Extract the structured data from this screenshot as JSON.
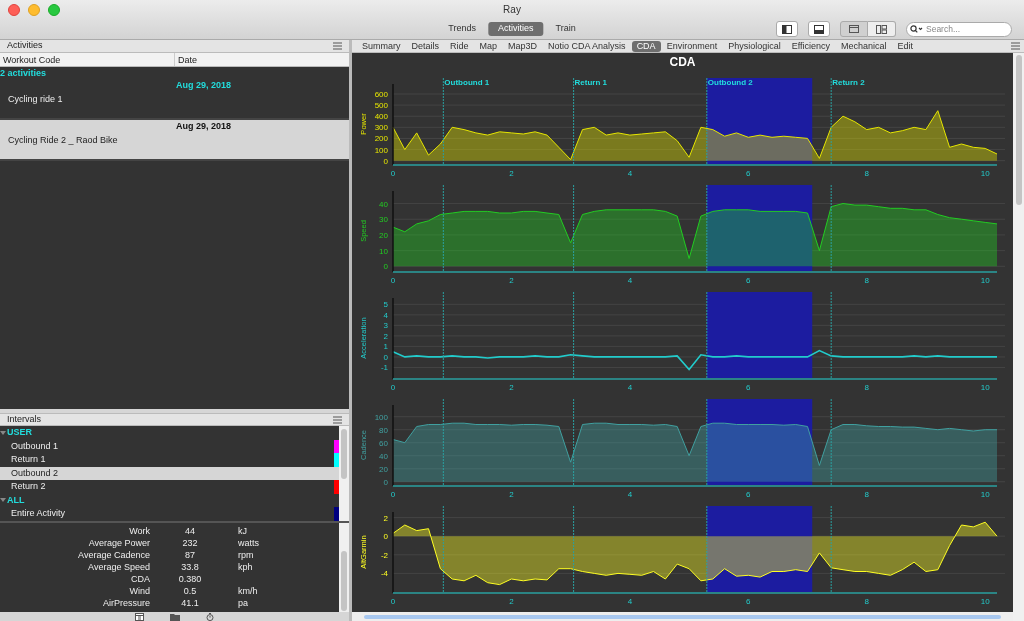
{
  "window": {
    "title": "Ray"
  },
  "view_tabs": [
    {
      "label": "Trends",
      "selected": false
    },
    {
      "label": "Activities",
      "selected": true
    },
    {
      "label": "Train",
      "selected": false
    }
  ],
  "search": {
    "placeholder": "Search..."
  },
  "activities_panel": {
    "title": "Activities",
    "columns": [
      "Workout Code",
      "Date"
    ],
    "group_label": "2 activities",
    "rows": [
      {
        "date": "Aug 29, 2018",
        "name": "Cycling ride 1",
        "selected": false
      },
      {
        "date": "Aug 29, 2018",
        "name": "Cycling Ride 2 _ Raod Bike",
        "selected": true
      }
    ]
  },
  "intervals_panel": {
    "title": "Intervals",
    "groups": [
      {
        "label": "USER",
        "expanded": true,
        "children": [
          {
            "label": "Outbound 1",
            "selected": false,
            "color": "#ff00ff"
          },
          {
            "label": "Return 1",
            "selected": false,
            "color": "#00ffff"
          },
          {
            "label": "Outbound 2",
            "selected": true
          },
          {
            "label": "Return 2",
            "selected": false,
            "color": "#ff0000"
          }
        ]
      },
      {
        "label": "ALL",
        "expanded": true,
        "children": [
          {
            "label": "Entire Activity",
            "selected": false,
            "color": "#000080"
          }
        ]
      }
    ]
  },
  "stats": [
    {
      "label": "Work",
      "value": "44",
      "unit": "kJ"
    },
    {
      "label": "Average Power",
      "value": "232",
      "unit": "watts"
    },
    {
      "label": "Average Cadence",
      "value": "87",
      "unit": "rpm"
    },
    {
      "label": "Average Speed",
      "value": "33.8",
      "unit": "kph"
    },
    {
      "label": "CDA",
      "value": "0.380"
    },
    {
      "label": "Wind",
      "value": "0.5",
      "unit": "km/h"
    },
    {
      "label": "AirPressure",
      "value": "41.1",
      "unit": "pa"
    }
  ],
  "tabs": [
    {
      "label": "Summary",
      "selected": false
    },
    {
      "label": "Details",
      "selected": false
    },
    {
      "label": "Ride",
      "selected": false
    },
    {
      "label": "Map",
      "selected": false
    },
    {
      "label": "Map3D",
      "selected": false
    },
    {
      "label": "Notio CDA Analysis",
      "selected": false
    },
    {
      "label": "CDA",
      "selected": true
    },
    {
      "label": "Environment",
      "selected": false
    },
    {
      "label": "Physiological",
      "selected": false
    },
    {
      "label": "Efficiency",
      "selected": false
    },
    {
      "label": "Mechanical",
      "selected": false
    },
    {
      "label": "Edit",
      "selected": false
    }
  ],
  "chart_title": "CDA",
  "charts": [
    {
      "chart_data": {
        "type": "area",
        "ylabel": "Power",
        "grid": true,
        "ref_lines": [
          {
            "axis": "x",
            "value": 0.85,
            "label": "Outbound 1"
          },
          {
            "axis": "x",
            "value": 3.05,
            "label": "Return 1"
          },
          {
            "axis": "x",
            "value": 5.3,
            "label": "Outbound 2"
          },
          {
            "axis": "x",
            "value": 7.4,
            "label": "Return 2"
          }
        ],
        "bands": [
          {
            "axis": "x",
            "from": 5.3,
            "to": 7.08
          }
        ],
        "xlim": [
          0,
          10.2
        ],
        "ylim": [
          -30,
          690
        ],
        "xticks": [
          0,
          2,
          4,
          6,
          8,
          10
        ],
        "yticks": [
          600,
          500,
          400,
          300,
          200,
          100,
          0
        ],
        "x": [
          0,
          0.2,
          0.4,
          0.6,
          0.8,
          1,
          1.2,
          1.4,
          1.6,
          1.8,
          2,
          2.2,
          2.4,
          2.6,
          2.8,
          3,
          3.2,
          3.4,
          3.6,
          3.8,
          4,
          4.2,
          4.4,
          4.6,
          4.8,
          5,
          5.2,
          5.4,
          5.6,
          5.8,
          6,
          6.2,
          6.4,
          6.6,
          6.8,
          7,
          7.2,
          7.4,
          7.6,
          7.8,
          8,
          8.2,
          8.4,
          8.6,
          8.8,
          9,
          9.2,
          9.4,
          9.6,
          9.8,
          10,
          10.2
        ],
        "series": [
          {
            "color": "#e6e600",
            "values": [
              300,
              100,
              250,
              50,
              150,
              300,
              280,
              250,
              230,
              260,
              250,
              240,
              260,
              230,
              120,
              10,
              280,
              300,
              230,
              250,
              230,
              240,
              250,
              260,
              180,
              30,
              300,
              280,
              220,
              250,
              210,
              230,
              210,
              220,
              210,
              200,
              20,
              300,
              400,
              350,
              280,
              300,
              250,
              270,
              300,
              280,
              450,
              120,
              150,
              120,
              110,
              60
            ]
          }
        ]
      }
    },
    {
      "chart_data": {
        "type": "area",
        "ylabel": "Speed",
        "grid": true,
        "ref_lines": [
          {
            "axis": "x",
            "value": 0.85
          },
          {
            "axis": "x",
            "value": 3.05
          },
          {
            "axis": "x",
            "value": 5.3
          },
          {
            "axis": "x",
            "value": 7.4
          }
        ],
        "bands": [
          {
            "axis": "x",
            "from": 5.3,
            "to": 7.08
          }
        ],
        "xlim": [
          0,
          10.2
        ],
        "ylim": [
          -3,
          48
        ],
        "xticks": [
          0,
          2,
          4,
          6,
          8,
          10
        ],
        "yticks": [
          40,
          30,
          20,
          10,
          0
        ],
        "x": [
          0,
          0.2,
          0.4,
          0.6,
          0.8,
          1,
          1.2,
          1.4,
          1.6,
          1.8,
          2,
          2.2,
          2.4,
          2.6,
          2.8,
          3,
          3.2,
          3.4,
          3.6,
          3.8,
          4,
          4.2,
          4.4,
          4.6,
          4.8,
          5,
          5.2,
          5.4,
          5.6,
          5.8,
          6,
          6.2,
          6.4,
          6.6,
          6.8,
          7,
          7.2,
          7.4,
          7.6,
          7.8,
          8,
          8.2,
          8.4,
          8.6,
          8.8,
          9,
          9.2,
          9.4,
          9.6,
          9.8,
          10,
          10.2
        ],
        "series": [
          {
            "color": "#22cc22",
            "values": [
              25,
              22,
              27,
              29,
              33,
              34,
              35,
              35,
              35,
              34,
              34,
              35,
              35,
              34,
              33,
              15,
              33,
              35,
              36,
              36,
              36,
              36,
              36,
              35,
              32,
              5,
              32,
              35,
              36,
              36,
              36,
              35,
              35,
              35,
              35,
              34,
              10,
              38,
              40,
              39,
              39,
              38,
              37,
              37,
              36,
              36,
              33,
              31,
              30,
              29,
              28,
              27
            ]
          }
        ]
      }
    },
    {
      "chart_data": {
        "type": "line",
        "ylabel": "Acceleration",
        "grid": true,
        "ref_lines": [
          {
            "axis": "x",
            "value": 0.85
          },
          {
            "axis": "x",
            "value": 3.05
          },
          {
            "axis": "x",
            "value": 5.3
          },
          {
            "axis": "x",
            "value": 7.4
          }
        ],
        "bands": [
          {
            "axis": "x",
            "from": 5.3,
            "to": 7.08
          }
        ],
        "xlim": [
          0,
          10.2
        ],
        "ylim": [
          -2,
          5.6
        ],
        "xticks": [
          0,
          2,
          4,
          6,
          8,
          10
        ],
        "yticks": [
          5,
          4,
          3,
          2,
          1,
          0,
          -1
        ],
        "x": [
          0,
          0.2,
          0.4,
          0.6,
          0.8,
          1,
          1.2,
          1.4,
          1.6,
          1.8,
          2,
          2.2,
          2.4,
          2.6,
          2.8,
          3,
          3.2,
          3.4,
          3.6,
          3.8,
          4,
          4.2,
          4.4,
          4.6,
          4.8,
          5,
          5.2,
          5.4,
          5.6,
          5.8,
          6,
          6.2,
          6.4,
          6.6,
          6.8,
          7,
          7.2,
          7.4,
          7.6,
          7.8,
          8,
          8.2,
          8.4,
          8.6,
          8.8,
          9,
          9.2,
          9.4,
          9.6,
          9.8,
          10,
          10.2
        ],
        "series": [
          {
            "color": "#22cccc",
            "values": [
              0.5,
              0,
              0.1,
              0,
              0,
              0.1,
              0,
              0,
              -0.1,
              0,
              0,
              0,
              0.1,
              0,
              0,
              0.2,
              0.1,
              0,
              0,
              0,
              0,
              0,
              0,
              0,
              0.1,
              -1.2,
              0.2,
              0,
              0,
              0.1,
              0,
              0,
              0,
              0,
              0,
              0,
              0.6,
              0.1,
              0,
              0,
              0,
              0,
              0,
              0,
              0.1,
              0,
              0.1,
              0,
              0,
              0,
              0,
              0
            ]
          }
        ]
      }
    },
    {
      "chart_data": {
        "type": "area",
        "ylabel": "Cadence",
        "grid": true,
        "ref_lines": [
          {
            "axis": "x",
            "value": 0.85
          },
          {
            "axis": "x",
            "value": 3.05
          },
          {
            "axis": "x",
            "value": 5.3
          },
          {
            "axis": "x",
            "value": 7.4
          }
        ],
        "bands": [
          {
            "axis": "x",
            "from": 5.3,
            "to": 7.08
          }
        ],
        "xlim": [
          0,
          10.2
        ],
        "ylim": [
          -5,
          118
        ],
        "xticks": [
          0,
          2,
          4,
          6,
          8,
          10
        ],
        "yticks": [
          100,
          80,
          60,
          40,
          20,
          0
        ],
        "x": [
          0,
          0.2,
          0.4,
          0.6,
          0.8,
          1,
          1.2,
          1.4,
          1.6,
          1.8,
          2,
          2.2,
          2.4,
          2.6,
          2.8,
          3,
          3.2,
          3.4,
          3.6,
          3.8,
          4,
          4.2,
          4.4,
          4.6,
          4.8,
          5,
          5.2,
          5.4,
          5.6,
          5.8,
          6,
          6.2,
          6.4,
          6.6,
          6.8,
          7,
          7.2,
          7.4,
          7.6,
          7.8,
          8,
          8.2,
          8.4,
          8.6,
          8.8,
          9,
          9.2,
          9.4,
          9.6,
          9.8,
          10,
          10.2
        ],
        "series": [
          {
            "color": "#40a0a0",
            "values": [
              65,
              60,
              85,
              88,
              88,
              90,
              90,
              88,
              88,
              88,
              87,
              88,
              88,
              87,
              85,
              30,
              88,
              90,
              90,
              88,
              88,
              88,
              87,
              88,
              85,
              40,
              85,
              90,
              90,
              88,
              88,
              88,
              88,
              87,
              88,
              85,
              25,
              80,
              88,
              88,
              86,
              85,
              85,
              84,
              84,
              82,
              80,
              82,
              80,
              78,
              80,
              80
            ]
          }
        ]
      }
    },
    {
      "chart_data": {
        "type": "area",
        "ylabel": "AltGarmin",
        "grid": true,
        "ref_lines": [
          {
            "axis": "x",
            "value": 0.85
          },
          {
            "axis": "x",
            "value": 3.05
          },
          {
            "axis": "x",
            "value": 5.3
          },
          {
            "axis": "x",
            "value": 7.4
          }
        ],
        "bands": [
          {
            "axis": "x",
            "from": 5.3,
            "to": 7.08
          }
        ],
        "xlim": [
          0,
          10.2
        ],
        "ylim": [
          -6,
          2.6
        ],
        "xticks": [
          0,
          2,
          4,
          6,
          8,
          10
        ],
        "yticks": [
          2,
          0,
          -2,
          -4
        ],
        "x": [
          0,
          0.2,
          0.4,
          0.6,
          0.8,
          1,
          1.2,
          1.4,
          1.6,
          1.8,
          2,
          2.2,
          2.4,
          2.6,
          2.8,
          3,
          3.2,
          3.4,
          3.6,
          3.8,
          4,
          4.2,
          4.4,
          4.6,
          4.8,
          5,
          5.2,
          5.4,
          5.6,
          5.8,
          6,
          6.2,
          6.4,
          6.6,
          6.8,
          7,
          7.2,
          7.4,
          7.6,
          7.8,
          8,
          8.2,
          8.4,
          8.6,
          8.8,
          9,
          9.2,
          9.4,
          9.6,
          9.8,
          10,
          10.2
        ],
        "series": [
          {
            "color": "#ffff22",
            "values": [
              0.3,
              1.2,
              0.6,
              0.8,
              -3.5,
              -4.6,
              -4.8,
              -4.2,
              -5.0,
              -5.2,
              -4.6,
              -4.8,
              -4.6,
              -4.7,
              -3.5,
              -3.5,
              -3.8,
              -4.0,
              -4.2,
              -4.0,
              -4.1,
              -4.2,
              -3.8,
              -4.6,
              -3.0,
              -3.5,
              -4.8,
              -4.6,
              -3.5,
              -4.3,
              -4.2,
              -4.4,
              -3.8,
              -3.8,
              -3.6,
              -3.8,
              -1.8,
              -3.4,
              -3.6,
              -3.8,
              -3.8,
              -4.0,
              -4.2,
              -3.6,
              -2.8,
              -3.8,
              -3.6,
              -1.0,
              1.2,
              1.0,
              1.5,
              0
            ]
          }
        ]
      }
    }
  ]
}
